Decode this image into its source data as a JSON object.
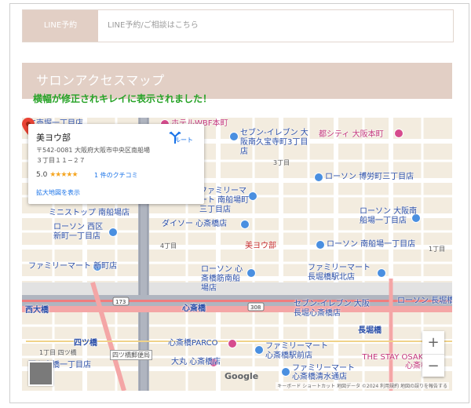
{
  "line": {
    "label": "LINE予約",
    "link_text": "LINE予約/ご相談はこちら"
  },
  "section": {
    "title": "サロンアクセスマップ",
    "note": "横幅が修正されキレイに表示されました！"
  },
  "map": {
    "card": {
      "name": "美ヨウ部",
      "address": "〒542-0081 大阪府大阪市中央区南船場３丁目１１−２７",
      "rating": "5.0",
      "stars": "★★★★★",
      "reviews": "1 件のクチコミ",
      "larger_map": "拡大地図を表示",
      "route": "ルート"
    },
    "marker_label": "美ヨウ部",
    "places": [
      "立売堀一丁目店",
      "ホテルWBF本町",
      "セブン-イレブン 大阪南久宝寺町3丁目店",
      "都シティ 大阪本町",
      "3丁目",
      "ローソン 博労町三丁目店",
      "ファミリーマート 南船場町三丁目店",
      "ミニストップ 南船場店",
      "ダイソー 心斎橋店",
      "ローソン 大阪南船場一丁目店",
      "ローソン 西区新町一丁目店",
      "4丁目",
      "ローソン 南船場一丁目店",
      "1丁目",
      "ファミリーマート 新町店",
      "ローソン 心斎橋筋南船場店",
      "ファミリーマート 長堀橋駅北店",
      "心斎橋",
      "セブン-イレブン 大阪長堀心斎橋店",
      "長堀橋",
      "ローソン 長堀橋店",
      "西大橋",
      "四ツ橋",
      "心斎橋PARCO",
      "ファミリーマート 心斎橋駅前店",
      "大丸 心斎橋店",
      "ファミリーマート 心斎橋清水通店",
      "THE STAY OSAKA 心斎橋",
      "西心斎橋一丁目店",
      "1丁目 四ツ橋",
      "四ツ橋郵便局"
    ],
    "road_badges": [
      "173",
      "308"
    ],
    "zoom_in": "+",
    "zoom_out": "−",
    "google": "Google",
    "attribution": "キーボード ショートカット 地図データ ©2024 利用規約 地図の誤りを報告する"
  }
}
